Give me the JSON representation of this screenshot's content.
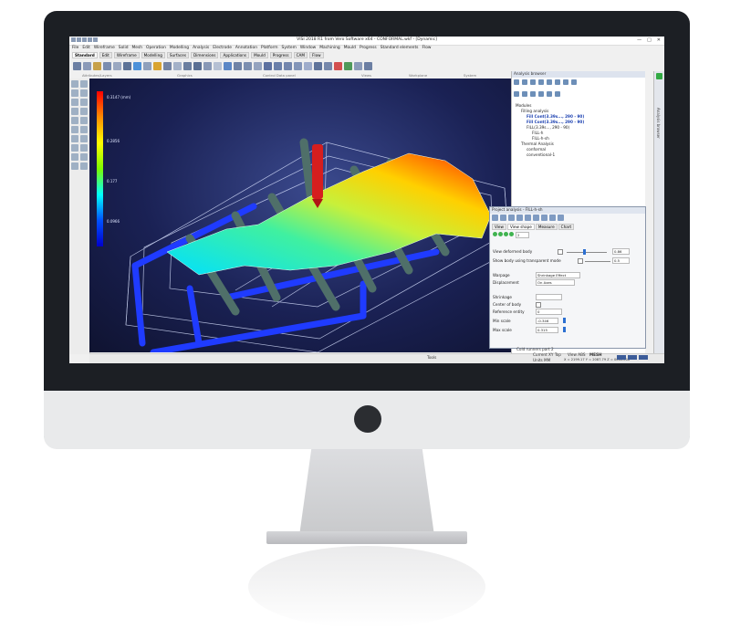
{
  "window": {
    "title": "VISI 2018 R1 from Vero Software x64 - CONFORMAL.wkf - [Dynamic]",
    "controls": [
      "—",
      "□",
      "✕"
    ]
  },
  "menu": [
    "File",
    "Edit",
    "Wireframe",
    "Solid",
    "Mesh",
    "Operation",
    "Modelling",
    "Analysis",
    "Electrode",
    "Annotation",
    "Platform",
    "System",
    "Window",
    "Machining",
    "Mould",
    "Progress",
    "Standard elements",
    "Flow"
  ],
  "tabs": [
    "Standard",
    "Edit",
    "Wireframe",
    "Modelling",
    "Surfaces",
    "Dimensions",
    "Applications",
    "Mould",
    "Progress",
    "CAM",
    "Flow"
  ],
  "toolbar_groups": [
    "Attributes/Layers",
    "Graphics",
    "Control Data panel",
    "Views",
    "Workplane",
    "System"
  ],
  "legend": {
    "labels": [
      "0.3147 (mm)",
      "0.2856",
      "0.177",
      "0.0966"
    ]
  },
  "browser": {
    "title": "Analysis browser",
    "tree": [
      "Modules",
      "Filling analysis",
      "Fill Cont(3.39s..., 290 - 90)",
      "Fill Cont(3.39s..., 290 - 90)",
      "FILL(3.39s..., 290 - 90)",
      "FILL-h",
      "FILL-h-sh",
      "Thermal Analysis",
      "conformal",
      "conventional-1"
    ]
  },
  "side_strip_label": "Analysis browser",
  "panel": {
    "title": "Project analysis - FILL-h-sh",
    "tabs": [
      "View",
      "View shape",
      "Measure",
      "Chart"
    ],
    "step_value": "2",
    "view_deformed_label": "View deformed body",
    "view_deformed_value": "0.86",
    "transparent_label": "Show body using transparent mode",
    "transparent_value": "0.5",
    "warpage_label": "Warpage",
    "warpage_value": "Shrinkage Effect",
    "displacement_label": "Displacement",
    "displacement_value": "On Axes",
    "shrinkage_label": "Shrinkage",
    "center_label": "Center of body",
    "reference_label": "Reference entity",
    "reference_value": "0",
    "min_scale_label": "Min scale",
    "min_scale_value": "-0.346",
    "max_scale_label": "Max scale",
    "max_scale_value": "0.315"
  },
  "status": {
    "left": "Tools",
    "current_set": "Cold runners part 2",
    "workplane": "Current XY Top",
    "units": "Units MM",
    "view": "View ABS",
    "mesh": "MESH",
    "coords": "X = 2199.17 Y = 2087.79 Z = 0000.000"
  },
  "colors": {
    "viewport_bg": "#1a2154",
    "accent": "#2c6fd1",
    "part_high": "#ff0000",
    "part_mid": "#00ffff",
    "cooling": "#1f3bff"
  }
}
